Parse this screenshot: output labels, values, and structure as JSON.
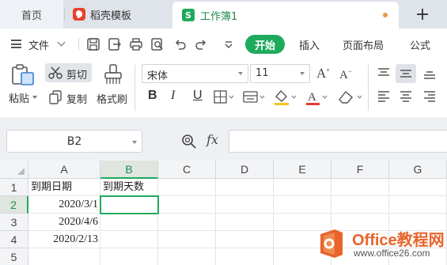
{
  "tabs": {
    "home": "首页",
    "template": "稻壳模板",
    "workbook": "工作簿1",
    "add": "+"
  },
  "menu": {
    "file": "文件",
    "start": "开始",
    "insert": "插入",
    "page_layout": "页面布局",
    "formulas": "公式"
  },
  "ribbon": {
    "paste": "粘贴",
    "cut": "剪切",
    "copy": "复制",
    "format_painter": "格式刷",
    "font_name": "宋体",
    "font_size": "11",
    "bold": "B",
    "italic": "I",
    "underline": "U"
  },
  "formula_bar": {
    "name_box": "B2",
    "fx": "fx",
    "value": ""
  },
  "grid": {
    "columns": [
      "A",
      "B",
      "C",
      "D",
      "E",
      "F",
      "G"
    ],
    "rows": [
      "1",
      "2",
      "3",
      "4",
      "5"
    ],
    "active_column": "B",
    "active_row": "2",
    "cells": {
      "A1": "到期日期",
      "B1": "到期天数",
      "A2": "2020/3/1",
      "A3": "2020/4/6",
      "A4": "2020/2/13"
    }
  },
  "watermark": {
    "title": "Office教程网",
    "url": "www.office26.com"
  },
  "colors": {
    "accent_green": "#1eaa5d",
    "wps_red": "#e8412c",
    "watermark_orange": "#e8642c"
  }
}
